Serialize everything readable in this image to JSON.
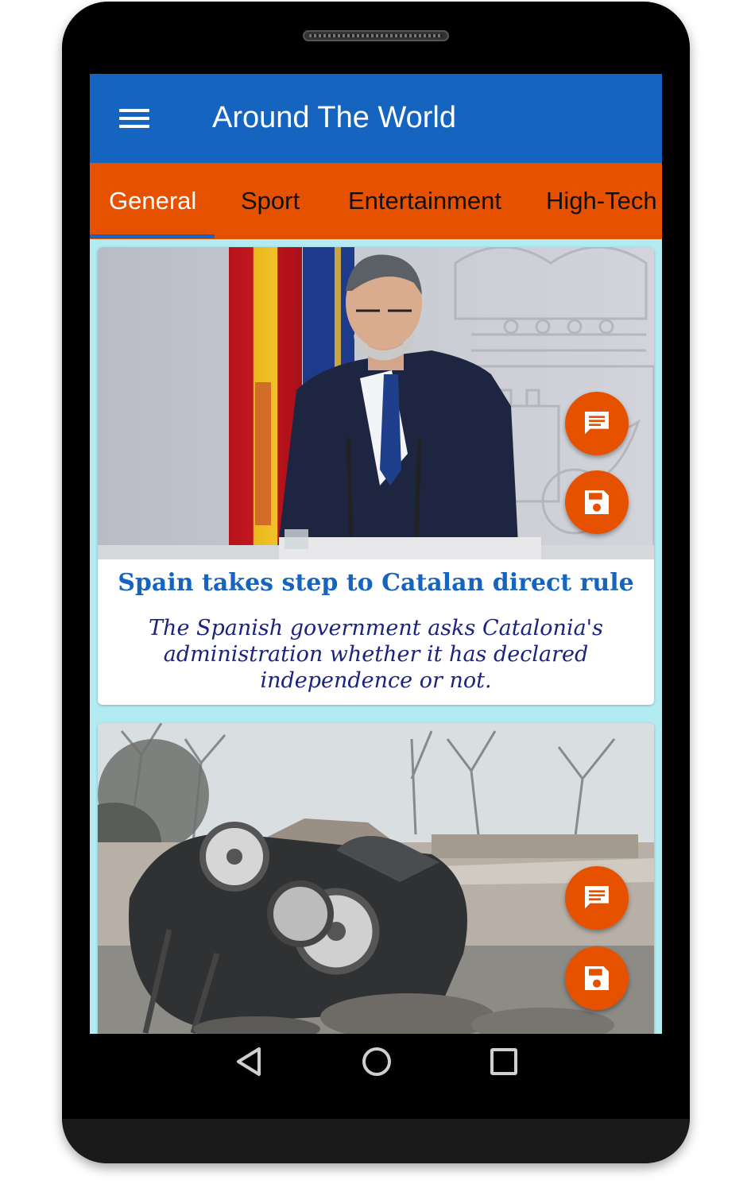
{
  "app": {
    "title": "Around The World"
  },
  "tabs": [
    {
      "label": "General",
      "active": true
    },
    {
      "label": "Sport",
      "active": false
    },
    {
      "label": "Entertainment",
      "active": false
    },
    {
      "label": "High-Tech",
      "active": false
    }
  ],
  "articles": [
    {
      "title": "Spain takes step to Catalan direct rule",
      "description": "The Spanish government asks Catalonia's administration whether it has declared independence or not.",
      "image_icon": "press-conference-photo"
    },
    {
      "title": "",
      "description": "",
      "image_icon": "burned-stroller-photo"
    }
  ],
  "actions": {
    "comment_icon": "comment-icon",
    "save_icon": "save-icon"
  },
  "navigation": {
    "back_icon": "back-icon",
    "home_icon": "home-icon",
    "recents_icon": "recents-icon"
  },
  "colors": {
    "appbar": "#1565c0",
    "tabs": "#e65100",
    "fab": "#e65100",
    "title_text": "#1565c0",
    "description_text": "#1a237e",
    "list_background": "#b2ebf2"
  }
}
